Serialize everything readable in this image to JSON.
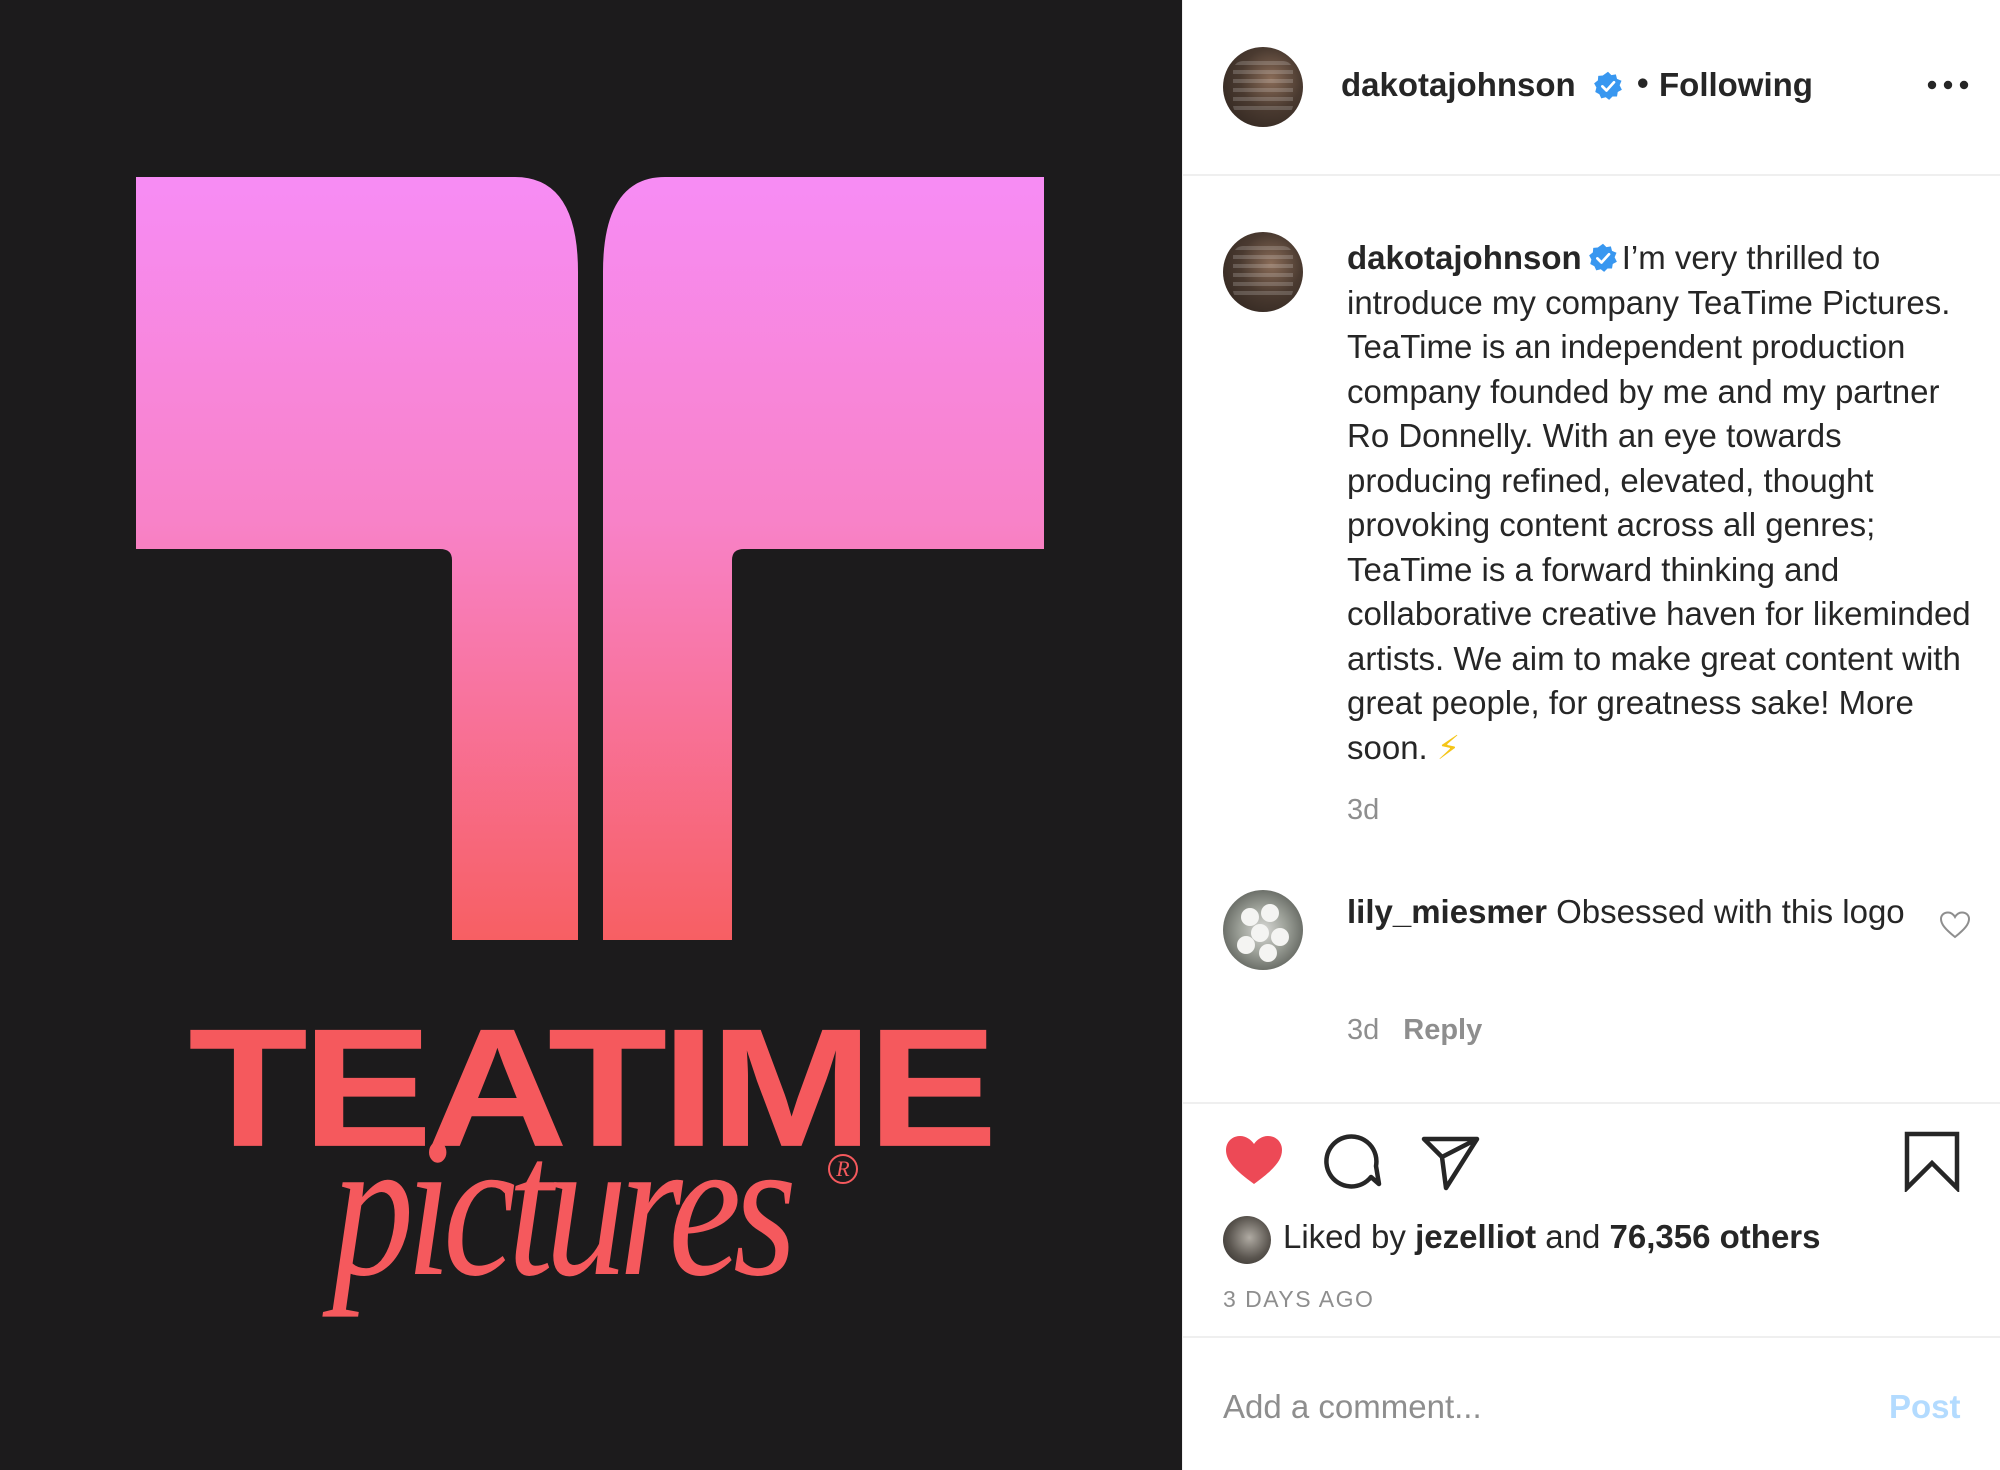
{
  "media": {
    "logo_word": "TEATIME",
    "logo_sub": "pictures",
    "logo_reg": "R",
    "colors": {
      "background": "#1c1b1c",
      "pink_top": "#f78cf5",
      "coral": "#f5595d"
    }
  },
  "header": {
    "username": "dakotajohnson",
    "verified_icon": "verified-badge-icon",
    "separator": "•",
    "follow_status": "Following",
    "more_icon": "more-options-icon"
  },
  "caption": {
    "username": "dakotajohnson",
    "text": "I’m very thrilled to introduce my company TeaTime Pictures. TeaTime is an independent production company founded by me and my partner Ro Donnelly. With an eye towards producing refined, elevated, thought provoking content across all genres; TeaTime is a forward thinking and collaborative creative haven for likeminded artists. We aim to make great content with great people, for greatness sake! More soon.",
    "emoji": "⚡",
    "time": "3d"
  },
  "comment": {
    "username": "lily_miesmer",
    "text": "Obsessed with this logo",
    "time": "3d",
    "reply_label": "Reply"
  },
  "actions": {
    "like_icon": "heart-filled-icon",
    "comment_icon": "comment-bubble-icon",
    "share_icon": "paper-plane-icon",
    "save_icon": "bookmark-icon",
    "liked_by_prefix": "Liked by",
    "liked_by_user": "jezelliot",
    "liked_by_and": "and",
    "liked_by_others": "76,356 others",
    "date": "3 DAYS AGO"
  },
  "composer": {
    "placeholder": "Add a comment...",
    "post_label": "Post"
  },
  "colors": {
    "text": "#262626",
    "muted": "#8e8e8e",
    "like_red": "#ed4956",
    "verified_blue": "#3897f0",
    "post_disabled": "#b3dbff"
  }
}
